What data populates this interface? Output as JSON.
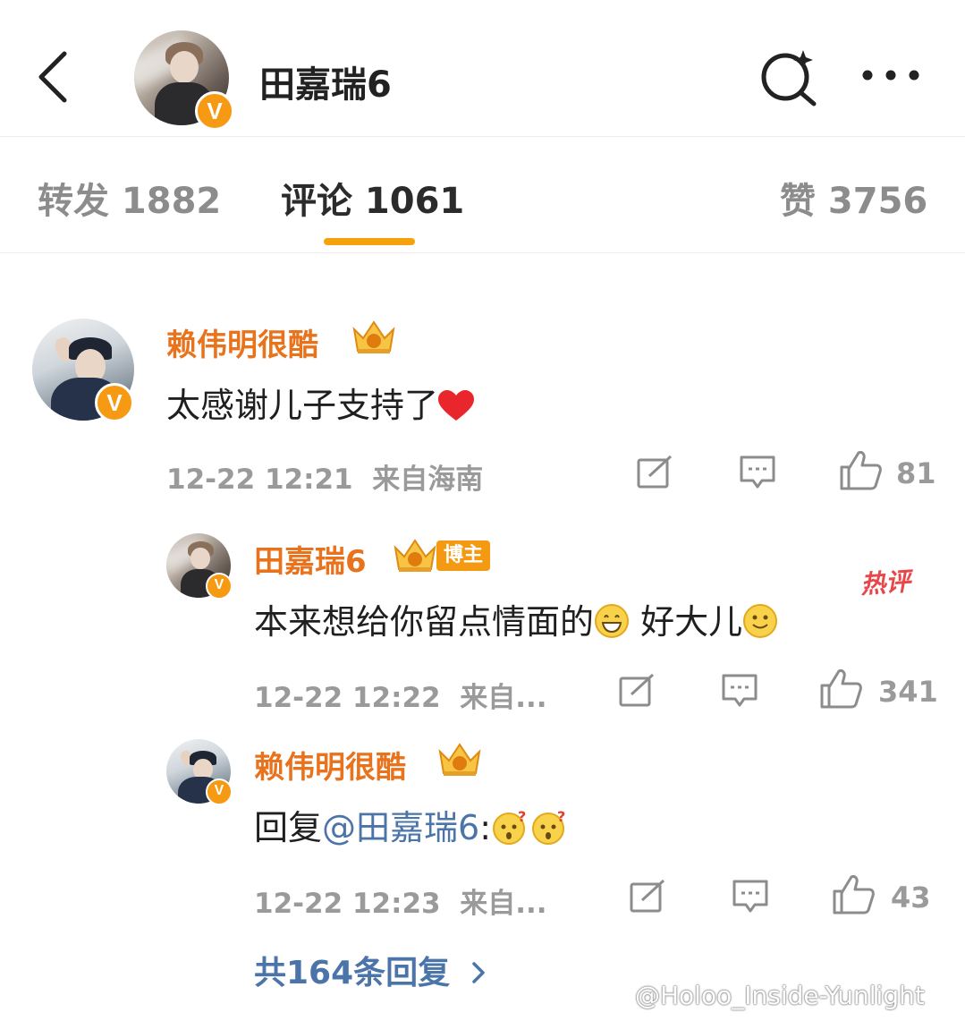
{
  "header": {
    "title": "田嘉瑞6",
    "back_icon": "chevron-left-icon",
    "search_icon": "search-sparkle-icon",
    "more_icon": "more-dots-icon",
    "avatar_badge": "V"
  },
  "tabs": [
    {
      "label": "转发 1882"
    },
    {
      "label": "评论 1061"
    },
    {
      "label": "赞 3756"
    }
  ],
  "colors": {
    "accent": "#f6a20e",
    "username": "#e8731c",
    "link": "#4b74a9",
    "hot": "#e8474a"
  },
  "comments": [
    {
      "username": "赖伟明很酷",
      "text": "太感谢儿子支持了",
      "emoji": "heart",
      "time": "12-22 12:21",
      "location": "来自海南",
      "likes": "81",
      "badge": "V"
    },
    {
      "username": "田嘉瑞6",
      "tag": "博主",
      "hot_label": "热评",
      "text_part1": "本来想给你留点情面的",
      "text_part2": " 好大儿",
      "time": "12-22 12:22",
      "location": "来自...",
      "likes": "341",
      "badge": "V"
    },
    {
      "username": "赖伟明很酷",
      "text_prefix": "回复",
      "mention": "@田嘉瑞6",
      "text_suffix": ":",
      "time": "12-22 12:23",
      "location": "来自...",
      "likes": "43",
      "badge": "V"
    }
  ],
  "replies_link": "共164条回复",
  "watermark": "@Holoo_Inside-Yunlight"
}
